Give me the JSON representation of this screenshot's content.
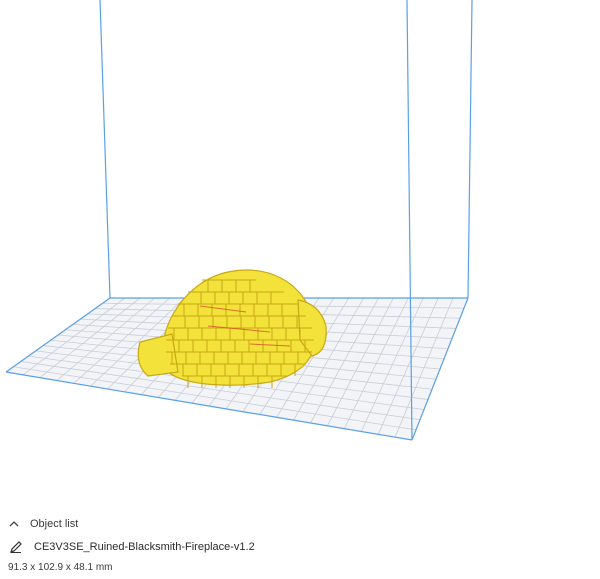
{
  "viewport": {
    "build_volume_color": "#5aa0e6",
    "bed_fill_color": "#f2f4f8",
    "grid_line_color": "#c9cdd6",
    "model_color": "#f2e23a",
    "model_shadow_color": "#c8a814",
    "model_detail_color": "#d63a2a",
    "model_name": "ruined-blacksmith-fireplace-model"
  },
  "object_list": {
    "header_label": "Object list",
    "collapse_icon": "chevron-up-icon",
    "edit_icon": "pencil-icon",
    "object_name": "CE3V3SE_Ruined-Blacksmith-Fireplace-v1.2",
    "dimensions": "91.3 x 102.9 x 48.1 mm"
  }
}
